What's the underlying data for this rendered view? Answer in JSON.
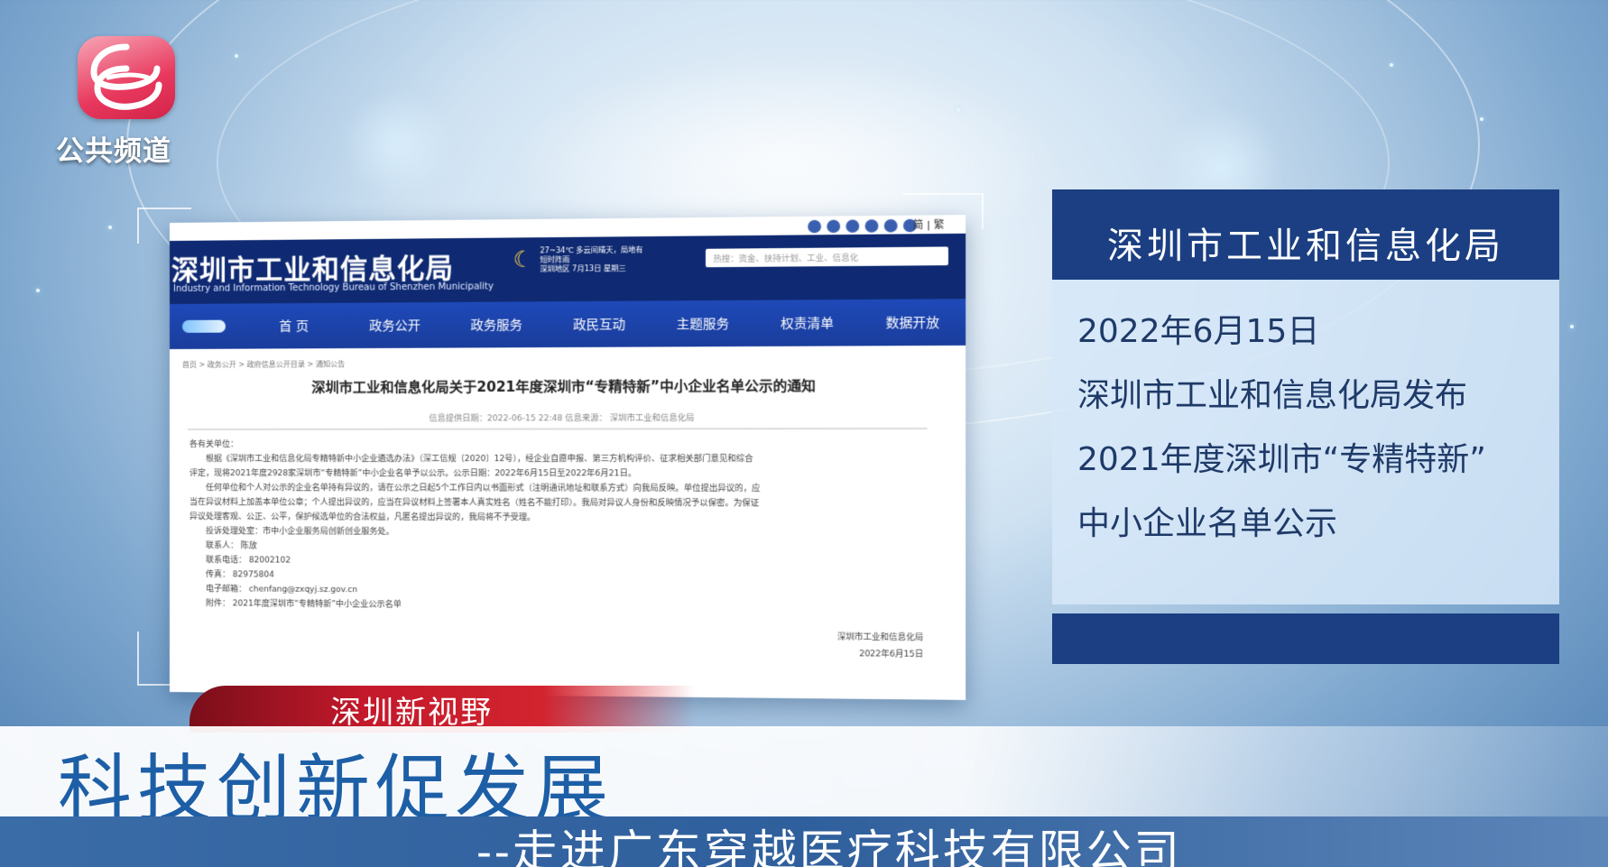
{
  "channel": {
    "logo_text": "公共频道",
    "logo_icon": "shenzhen-tv-logo-icon",
    "brand_color": "#e8385d"
  },
  "webpage": {
    "site_title": "深圳市工业和信息化局",
    "site_subtitle": "Industry and Information Technology Bureau of Shenzhen Municipality",
    "weather_line1": "27~34℃  多云间晴天，局地有",
    "weather_line2": "短时阵雨",
    "weather_line3": "深圳地区 7月13日  星期三",
    "search_placeholder": "热搜：资金、扶持计划、工业、信息化",
    "lang": "简 | 繁",
    "nav": [
      "首 页",
      "政务公开",
      "政务服务",
      "政民互动",
      "主题服务",
      "权责清单",
      "数据开放"
    ],
    "breadcrumb": "首页  >  政务公开  >  政府信息公开目录  >  通知公告",
    "article_title": "深圳市工业和信息化局关于2021年度深圳市“专精特新”中小企业名单公示的通知",
    "meta": "信息提供日期：2022-06-15 22:48    信息来源：  深圳市工业和信息化局",
    "body": [
      "各有关单位：",
      "根据《深圳市工业和信息化局专精特新中小企业遴选办法》（深工信规〔2020〕12号），经企业自愿申报、第三方机构评价、征求相关部门意见和综合",
      "评定，现将2021年度2928家深圳市“专精特新”中小企业名单予以公示。公示日期：2022年6月15日至2022年6月21日。",
      "任何单位和个人对公示的企业名单持有异议的，请在公示之日起5个工作日内以书面形式（注明通讯地址和联系方式）向我局反映。单位提出异议的，应",
      "当在异议材料上加盖本单位公章；个人提出异议的，应当在异议材料上签署本人真实姓名（姓名不能打印）。我局对异议人身份和反映情况予以保密。为保证",
      "异议处理客观、公正、公平，保护候选单位的合法权益，凡匿名提出异议的，我局将不予受理。",
      "投诉处理处室：市中小企业服务局创新创业服务处。",
      "联系人：  陈放",
      "联系电话：  82002102",
      "传真：  82975804",
      "电子邮箱：  chenfang@zxqyj.sz.gov.cn",
      "附件：  2021年度深圳市“专精特新”中小企业公示名单"
    ],
    "sign_org": "深圳市工业和信息化局",
    "sign_date": "2022年6月15日"
  },
  "info_panel": {
    "heading": "深圳市工业和信息化局",
    "lines": [
      "2022年6月15日",
      "深圳市工业和信息化局发布",
      "2021年度深圳市“专精特新”",
      "中小企业名单公示"
    ]
  },
  "lower_third": {
    "program": "深圳新视野",
    "title": "科技创新促发展",
    "subtitle": "--走进广东穿越医疗科技有限公司"
  }
}
